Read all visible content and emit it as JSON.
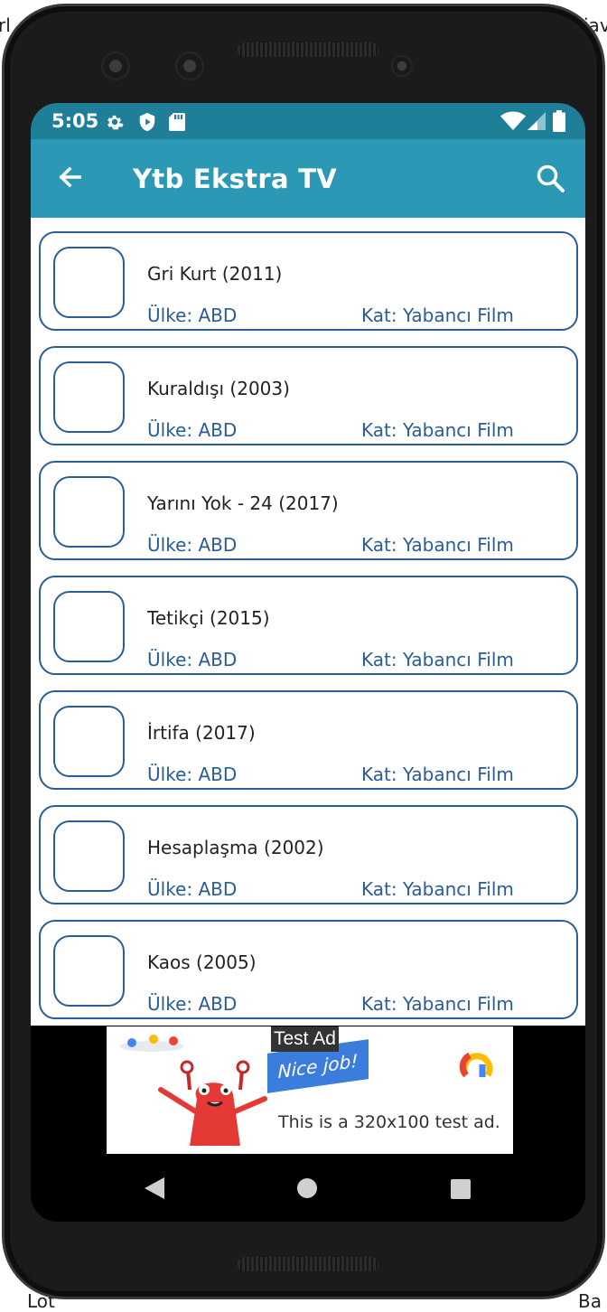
{
  "background_fragments": {
    "top_left": "rl",
    "top_right": "iav",
    "bottom_left": "Lot",
    "bottom_right": "Ba"
  },
  "status_bar": {
    "time": "5:05",
    "icons": [
      "settings-icon",
      "play-protect-icon",
      "sd-card-icon",
      "wifi-icon",
      "signal-icon",
      "battery-icon"
    ],
    "color": "#1f7f99"
  },
  "app_bar": {
    "title": "Ytb Ekstra TV",
    "back_icon": "arrow-back-icon",
    "search_icon": "search-icon",
    "color": "#2b98b6"
  },
  "list": {
    "items": [
      {
        "title": "Gri Kurt (2011)",
        "country": "Ülke: ABD",
        "category": "Kat: Yabancı Film"
      },
      {
        "title": "Kuraldışı (2003)",
        "country": "Ülke: ABD",
        "category": "Kat: Yabancı Film"
      },
      {
        "title": "Yarını Yok - 24 (2017)",
        "country": "Ülke: ABD",
        "category": "Kat: Yabancı Film"
      },
      {
        "title": "Tetikçi (2015)",
        "country": "Ülke: ABD",
        "category": "Kat: Yabancı Film"
      },
      {
        "title": "İrtifa (2017)",
        "country": "Ülke: ABD",
        "category": "Kat: Yabancı Film"
      },
      {
        "title": "Hesaplaşma (2002)",
        "country": "Ülke: ABD",
        "category": "Kat: Yabancı Film"
      },
      {
        "title": "Kaos (2005)",
        "country": "Ülke: ABD",
        "category": "Kat: Yabancı Film"
      }
    ],
    "accent": "#2a5c96"
  },
  "ad": {
    "label": "Test Ad",
    "banner": "Nice job!",
    "text": "This is a 320x100 test ad."
  },
  "nav_bar": {
    "icons": [
      "back-triangle-icon",
      "home-circle-icon",
      "recents-square-icon"
    ]
  }
}
